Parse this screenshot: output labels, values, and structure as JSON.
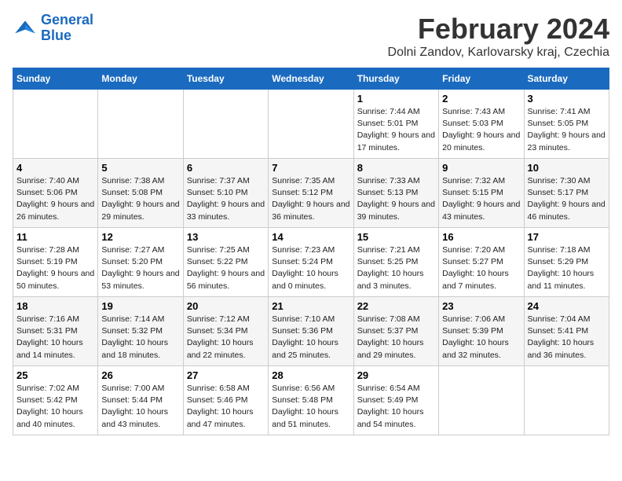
{
  "header": {
    "logo_line1": "General",
    "logo_line2": "Blue",
    "month_year": "February 2024",
    "location": "Dolni Zandov, Karlovarsky kraj, Czechia"
  },
  "days_of_week": [
    "Sunday",
    "Monday",
    "Tuesday",
    "Wednesday",
    "Thursday",
    "Friday",
    "Saturday"
  ],
  "weeks": [
    [
      {
        "day": "",
        "info": ""
      },
      {
        "day": "",
        "info": ""
      },
      {
        "day": "",
        "info": ""
      },
      {
        "day": "",
        "info": ""
      },
      {
        "day": "1",
        "info": "Sunrise: 7:44 AM\nSunset: 5:01 PM\nDaylight: 9 hours and 17 minutes."
      },
      {
        "day": "2",
        "info": "Sunrise: 7:43 AM\nSunset: 5:03 PM\nDaylight: 9 hours and 20 minutes."
      },
      {
        "day": "3",
        "info": "Sunrise: 7:41 AM\nSunset: 5:05 PM\nDaylight: 9 hours and 23 minutes."
      }
    ],
    [
      {
        "day": "4",
        "info": "Sunrise: 7:40 AM\nSunset: 5:06 PM\nDaylight: 9 hours and 26 minutes."
      },
      {
        "day": "5",
        "info": "Sunrise: 7:38 AM\nSunset: 5:08 PM\nDaylight: 9 hours and 29 minutes."
      },
      {
        "day": "6",
        "info": "Sunrise: 7:37 AM\nSunset: 5:10 PM\nDaylight: 9 hours and 33 minutes."
      },
      {
        "day": "7",
        "info": "Sunrise: 7:35 AM\nSunset: 5:12 PM\nDaylight: 9 hours and 36 minutes."
      },
      {
        "day": "8",
        "info": "Sunrise: 7:33 AM\nSunset: 5:13 PM\nDaylight: 9 hours and 39 minutes."
      },
      {
        "day": "9",
        "info": "Sunrise: 7:32 AM\nSunset: 5:15 PM\nDaylight: 9 hours and 43 minutes."
      },
      {
        "day": "10",
        "info": "Sunrise: 7:30 AM\nSunset: 5:17 PM\nDaylight: 9 hours and 46 minutes."
      }
    ],
    [
      {
        "day": "11",
        "info": "Sunrise: 7:28 AM\nSunset: 5:19 PM\nDaylight: 9 hours and 50 minutes."
      },
      {
        "day": "12",
        "info": "Sunrise: 7:27 AM\nSunset: 5:20 PM\nDaylight: 9 hours and 53 minutes."
      },
      {
        "day": "13",
        "info": "Sunrise: 7:25 AM\nSunset: 5:22 PM\nDaylight: 9 hours and 56 minutes."
      },
      {
        "day": "14",
        "info": "Sunrise: 7:23 AM\nSunset: 5:24 PM\nDaylight: 10 hours and 0 minutes."
      },
      {
        "day": "15",
        "info": "Sunrise: 7:21 AM\nSunset: 5:25 PM\nDaylight: 10 hours and 3 minutes."
      },
      {
        "day": "16",
        "info": "Sunrise: 7:20 AM\nSunset: 5:27 PM\nDaylight: 10 hours and 7 minutes."
      },
      {
        "day": "17",
        "info": "Sunrise: 7:18 AM\nSunset: 5:29 PM\nDaylight: 10 hours and 11 minutes."
      }
    ],
    [
      {
        "day": "18",
        "info": "Sunrise: 7:16 AM\nSunset: 5:31 PM\nDaylight: 10 hours and 14 minutes."
      },
      {
        "day": "19",
        "info": "Sunrise: 7:14 AM\nSunset: 5:32 PM\nDaylight: 10 hours and 18 minutes."
      },
      {
        "day": "20",
        "info": "Sunrise: 7:12 AM\nSunset: 5:34 PM\nDaylight: 10 hours and 22 minutes."
      },
      {
        "day": "21",
        "info": "Sunrise: 7:10 AM\nSunset: 5:36 PM\nDaylight: 10 hours and 25 minutes."
      },
      {
        "day": "22",
        "info": "Sunrise: 7:08 AM\nSunset: 5:37 PM\nDaylight: 10 hours and 29 minutes."
      },
      {
        "day": "23",
        "info": "Sunrise: 7:06 AM\nSunset: 5:39 PM\nDaylight: 10 hours and 32 minutes."
      },
      {
        "day": "24",
        "info": "Sunrise: 7:04 AM\nSunset: 5:41 PM\nDaylight: 10 hours and 36 minutes."
      }
    ],
    [
      {
        "day": "25",
        "info": "Sunrise: 7:02 AM\nSunset: 5:42 PM\nDaylight: 10 hours and 40 minutes."
      },
      {
        "day": "26",
        "info": "Sunrise: 7:00 AM\nSunset: 5:44 PM\nDaylight: 10 hours and 43 minutes."
      },
      {
        "day": "27",
        "info": "Sunrise: 6:58 AM\nSunset: 5:46 PM\nDaylight: 10 hours and 47 minutes."
      },
      {
        "day": "28",
        "info": "Sunrise: 6:56 AM\nSunset: 5:48 PM\nDaylight: 10 hours and 51 minutes."
      },
      {
        "day": "29",
        "info": "Sunrise: 6:54 AM\nSunset: 5:49 PM\nDaylight: 10 hours and 54 minutes."
      },
      {
        "day": "",
        "info": ""
      },
      {
        "day": "",
        "info": ""
      }
    ]
  ]
}
